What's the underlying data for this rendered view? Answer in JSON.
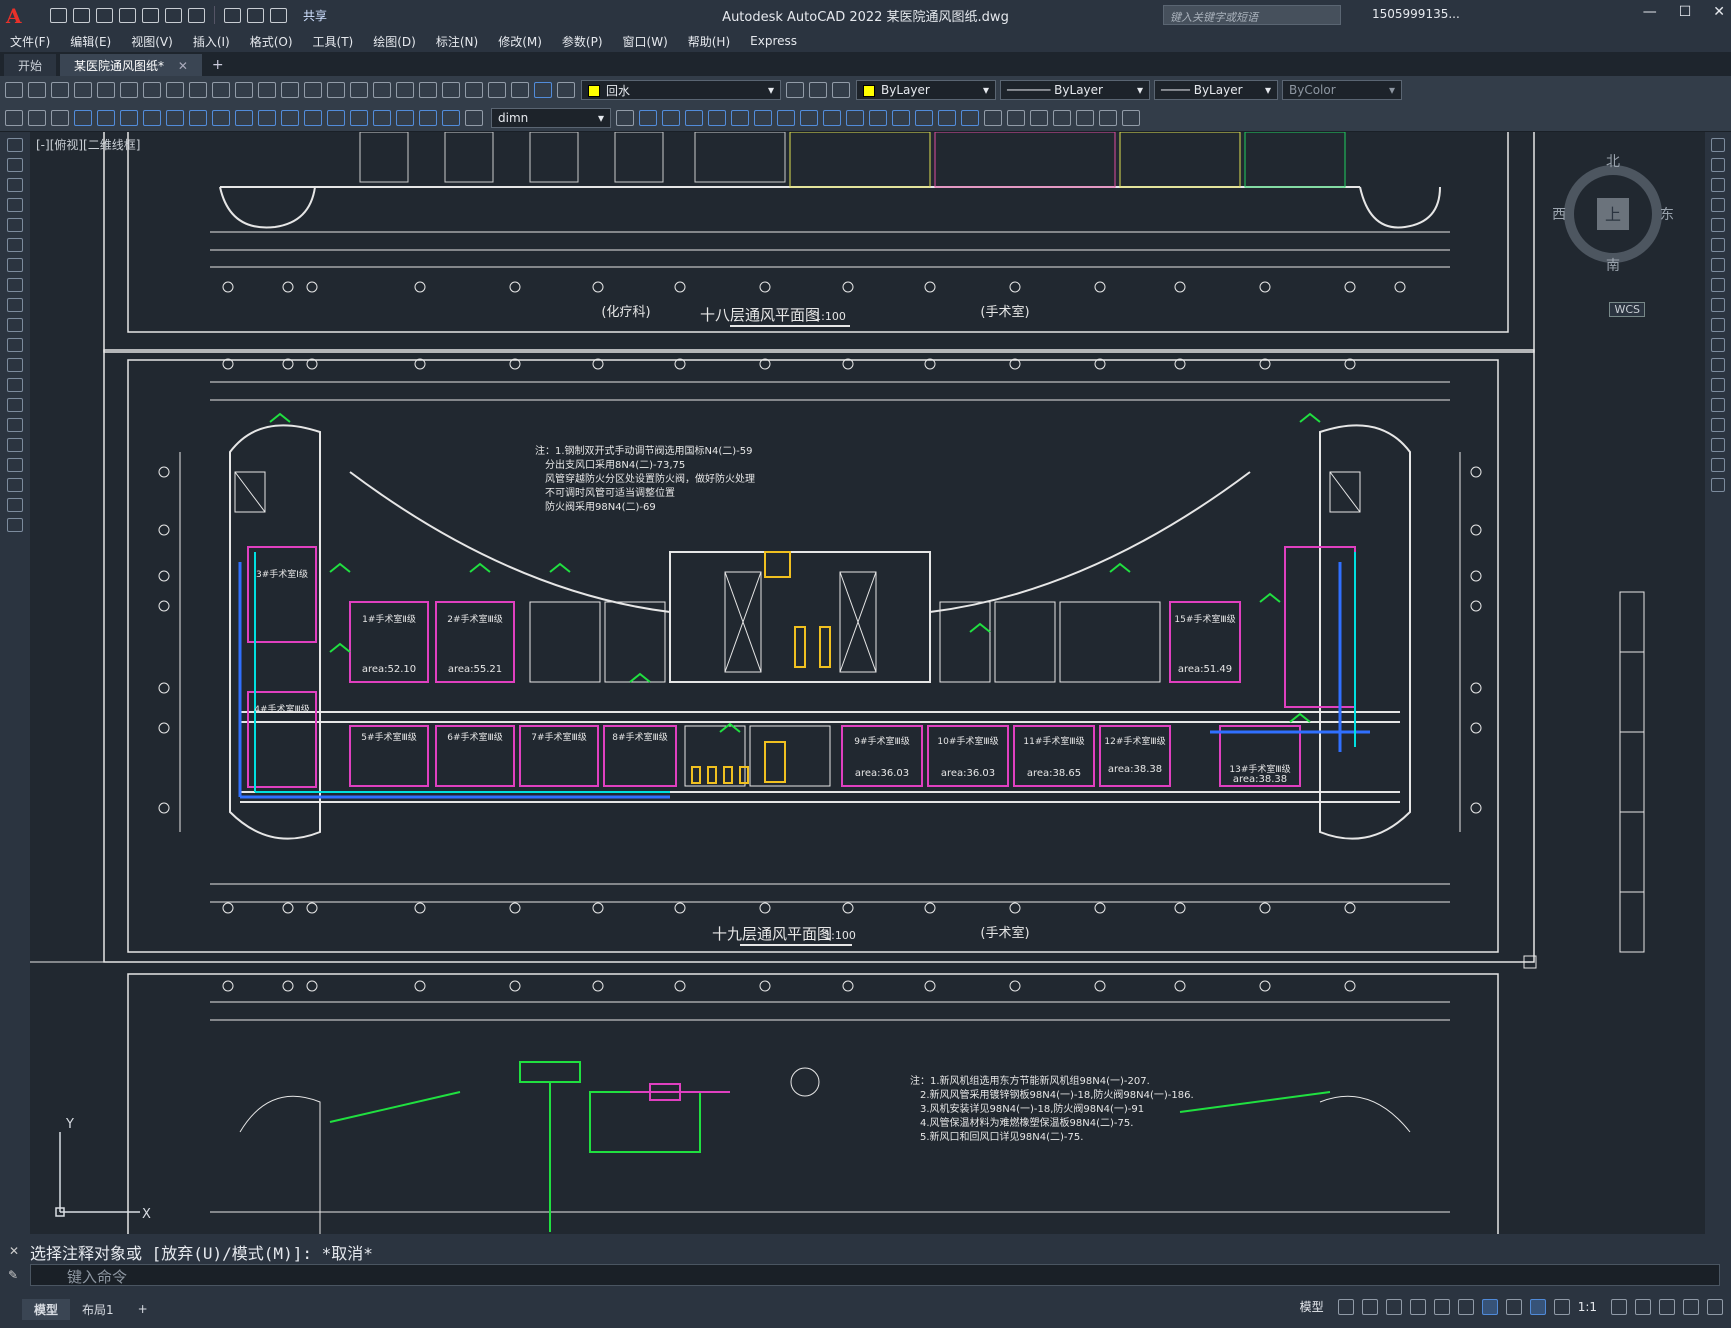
{
  "titlebar": {
    "logo": "A",
    "share": "共享",
    "title": "Autodesk AutoCAD 2022    某医院通风图纸.dwg",
    "search_placeholder": "键入关键字或短语",
    "user": "1505999135...",
    "minimize": "—",
    "maximize": "☐",
    "close": "✕"
  },
  "menu": [
    "文件(F)",
    "编辑(E)",
    "视图(V)",
    "插入(I)",
    "格式(O)",
    "工具(T)",
    "绘图(D)",
    "标注(N)",
    "修改(M)",
    "参数(P)",
    "窗口(W)",
    "帮助(H)",
    "Express"
  ],
  "tabs": {
    "start": "开始",
    "doc": "某医院通风图纸*",
    "close": "✕",
    "new": "+"
  },
  "properties": {
    "layer": "回水",
    "color": "ByLayer",
    "linetype": "ByLayer",
    "lineweight": "ByLayer",
    "plotstyle": "ByColor",
    "dimstyle": "dimn"
  },
  "viewport": {
    "label": "[-][俯视][二维线框]",
    "compass": {
      "n": "北",
      "s": "南",
      "e": "东",
      "w": "西",
      "center": "上"
    },
    "wcs": "WCS",
    "ucs_y": "Y",
    "ucs_x": "X"
  },
  "drawing": {
    "plan18_title": "十八层通风平面图",
    "plan18_scale": "1:100",
    "plan18_left": "(化疗科)",
    "plan18_right": "(手术室)",
    "plan19_title": "十九层通风平面图",
    "plan19_scale": "1:100",
    "plan19_right": "(手术室)",
    "notes": [
      "注：1.钢制双开式手动调节阀选用国标N4(二)-59",
      "分出支风口采用8N4(二)-73,75",
      "风管穿越防火分区处设置防火阀，做好防火处理",
      "不可调时风管可适当调整位置",
      "防火阀采用98N4(二)-69"
    ],
    "rooms": [
      {
        "label": "3#手术室Ⅰ级"
      },
      {
        "label": "1#手术室Ⅱ级",
        "area": "area:52.10"
      },
      {
        "label": "2#手术室Ⅲ级",
        "area": "area:55.21"
      },
      {
        "label": "4#手术室Ⅲ级"
      },
      {
        "label": "5#手术室Ⅲ级"
      },
      {
        "label": "6#手术室Ⅲ级"
      },
      {
        "label": "7#手术室Ⅲ级"
      },
      {
        "label": "8#手术室Ⅲ级"
      },
      {
        "label": "9#手术室Ⅲ级",
        "area": "area:36.03"
      },
      {
        "label": "10#手术室Ⅲ级",
        "area": "area:36.03"
      },
      {
        "label": "11#手术室Ⅲ级",
        "area": "area:38.65"
      },
      {
        "label": "12#手术室Ⅲ级",
        "area": "area:38.38"
      },
      {
        "label": "13#手术室Ⅲ级",
        "area": "area:38.38"
      },
      {
        "label": "15#手术室Ⅲ级",
        "area": "area:51.49"
      }
    ],
    "notes_bottom": [
      "注：1.新风机组选用东方节能新风机组98N4(一)-207.",
      "2.新风风管采用镀锌钢板98N4(一)-18,防火阀98N4(一)-186.",
      "3.风机安装详见98N4(一)-18,防火阀98N4(一)-91",
      "4.风管保温材料为难燃橡塑保温板98N4(二)-75.",
      "5.新风口和回风口详见98N4(二)-75."
    ]
  },
  "command": {
    "history": "选择注释对象或 [放弃(U)/模式(M)]: *取消*",
    "placeholder": "键入命令"
  },
  "status": {
    "model_tab": "模型",
    "layout_tab": "布局1",
    "add": "+",
    "model": "模型",
    "scale": "1:1"
  }
}
